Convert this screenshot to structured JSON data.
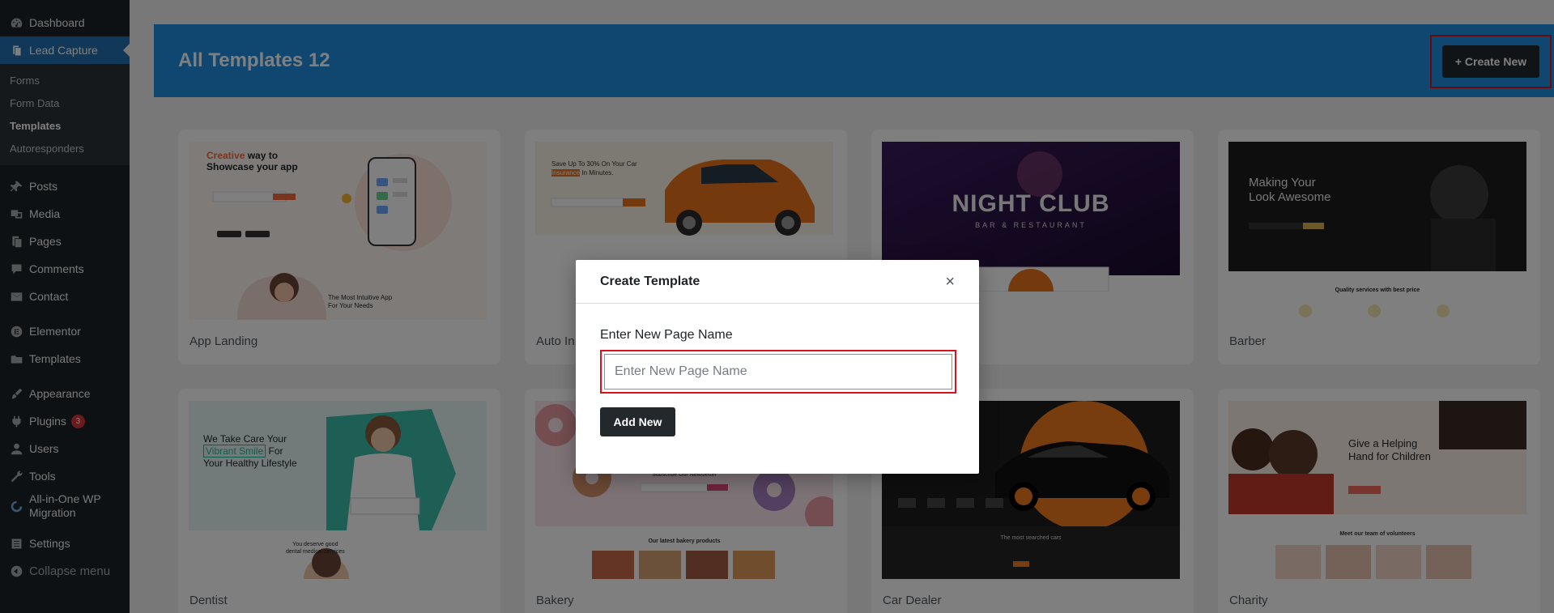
{
  "sidebar": {
    "items": [
      {
        "label": "Dashboard",
        "icon": "dashboard-icon"
      },
      {
        "label": "Lead Capture",
        "icon": "lead-capture-icon"
      },
      {
        "label": "Posts",
        "icon": "pin-icon"
      },
      {
        "label": "Media",
        "icon": "media-icon"
      },
      {
        "label": "Pages",
        "icon": "pages-icon"
      },
      {
        "label": "Comments",
        "icon": "comments-icon"
      },
      {
        "label": "Contact",
        "icon": "mail-icon"
      },
      {
        "label": "Elementor",
        "icon": "elementor-icon"
      },
      {
        "label": "Templates",
        "icon": "folder-icon"
      },
      {
        "label": "Appearance",
        "icon": "brush-icon"
      },
      {
        "label": "Plugins",
        "icon": "plugin-icon",
        "badge": "3"
      },
      {
        "label": "Users",
        "icon": "user-icon"
      },
      {
        "label": "Tools",
        "icon": "wrench-icon"
      },
      {
        "label_line1": "All-in-One WP",
        "label_line2": "Migration",
        "icon": "migration-icon"
      },
      {
        "label": "Settings",
        "icon": "settings-icon"
      },
      {
        "label": "Collapse menu",
        "icon": "collapse-icon"
      }
    ],
    "submenu": [
      "Forms",
      "Form Data",
      "Templates",
      "Autoresponders"
    ]
  },
  "header": {
    "title": "All Templates 12",
    "create_label": "+ Create New"
  },
  "cards": [
    {
      "name": "App Landing"
    },
    {
      "name": "Auto In"
    },
    {
      "name": ""
    },
    {
      "name": "Barber"
    },
    {
      "name": "Dentist"
    },
    {
      "name": "Bakery"
    },
    {
      "name": "Car Dealer"
    },
    {
      "name": "Charity"
    }
  ],
  "thumbs": {
    "app_landing": {
      "t1": "Creative",
      "t2": "way to",
      "t3": "Showcase your app",
      "t4": "The Most Intuitive App",
      "t5": "For Your Needs"
    },
    "auto": {
      "t1": "Save Up To 30% On Your Car",
      "t2": "Insurance",
      "t3": "In Minutes."
    },
    "nightclub": {
      "t1": "NIGHT CLUB",
      "t2": "BAR & RESTAURANT"
    },
    "barber": {
      "t1": "Making Your",
      "t2": "Look Awesome",
      "t3": "Quality services with best price"
    },
    "dentist": {
      "t1": "We Take Care Your",
      "t2": "Vibrant Smile",
      "t3": "For",
      "t4": "Your Healthy Lifestyle",
      "t5": "You deserve good",
      "t6": "dental medical services"
    },
    "bakery": {
      "t1": "Subscribe Our Newsletter",
      "t2": "Our latest bakery products"
    },
    "car_dealer": {
      "t1": "The most searched cars"
    },
    "charity": {
      "t1": "Give a Helping",
      "t2": "Hand for Children",
      "t3": "Meet our team of volunteers"
    }
  },
  "modal": {
    "title": "Create Template",
    "close": "×",
    "field_label": "Enter New Page Name",
    "placeholder": "Enter New Page Name",
    "submit_label": "Add New"
  },
  "colors": {
    "sidebar_bg": "#1d2327",
    "accent": "#2271b1",
    "header_bg": "#1f8ee0",
    "highlight_border": "#d9131d"
  }
}
